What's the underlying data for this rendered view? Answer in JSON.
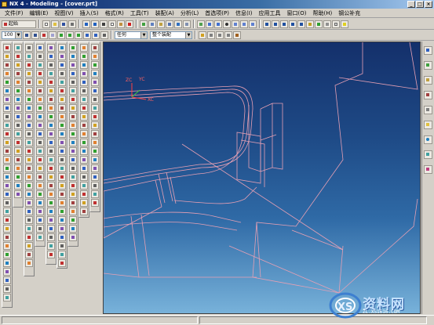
{
  "window": {
    "title": "NX 4 - Modeling - [cover.prt]",
    "minimize": "_",
    "restore": "□",
    "close": "×"
  },
  "menu": [
    "文件(F)",
    "编辑(E)",
    "视图(V)",
    "插入(S)",
    "格式(R)",
    "工具(T)",
    "装配(A)",
    "分析(L)",
    "首选项(P)",
    "信息(I)",
    "应用工具",
    "窗口(O)",
    "帮助(H)",
    "钢公补充"
  ],
  "toolbar1": {
    "start_label": "起始",
    "start_icon": "start-icon"
  },
  "toolbar2": {
    "zoom_value": "100",
    "filter_value": "任何",
    "scope_value": "整个装配"
  },
  "viewport": {
    "background_top": "#14306b",
    "background_bottom": "#78b2da",
    "edge_color": "#e6a0b4",
    "axis_labels": {
      "x": "XC",
      "y": "YC",
      "z": "ZC"
    }
  },
  "watermark": {
    "brand": "资料网",
    "logo_letters": "XS",
    "url": "ZL.XS1616.COM"
  }
}
